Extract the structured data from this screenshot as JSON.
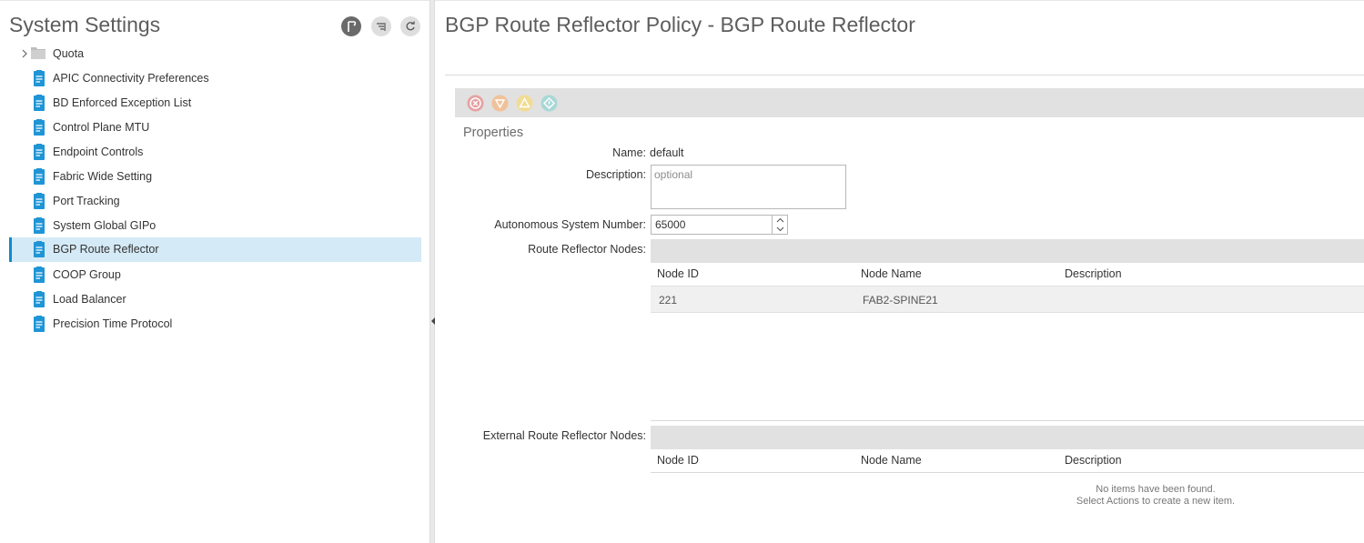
{
  "left_panel": {
    "title": "System Settings",
    "header_buttons": [
      "pin-icon",
      "filter-list-icon",
      "refresh-icon"
    ],
    "tree": [
      {
        "label": "Quota",
        "icon": "folder-icon",
        "expandable": true
      },
      {
        "label": "APIC Connectivity Preferences",
        "icon": "policy-doc-icon"
      },
      {
        "label": "BD Enforced Exception List",
        "icon": "policy-doc-icon"
      },
      {
        "label": "Control Plane MTU",
        "icon": "policy-doc-icon"
      },
      {
        "label": "Endpoint Controls",
        "icon": "policy-doc-icon"
      },
      {
        "label": "Fabric Wide Setting",
        "icon": "policy-doc-icon"
      },
      {
        "label": "Port Tracking",
        "icon": "policy-doc-icon"
      },
      {
        "label": "System Global GIPo",
        "icon": "policy-doc-icon"
      },
      {
        "label": "BGP Route Reflector",
        "icon": "policy-doc-icon",
        "selected": true
      },
      {
        "label": "COOP Group",
        "icon": "policy-doc-icon"
      },
      {
        "label": "Load Balancer",
        "icon": "policy-doc-icon"
      },
      {
        "label": "Precision Time Protocol",
        "icon": "policy-doc-icon"
      }
    ]
  },
  "main": {
    "title": "BGP Route Reflector Policy - BGP Route Reflector",
    "fault_icons": [
      "critical-fault-icon",
      "major-fault-icon",
      "minor-fault-icon",
      "warning-fault-icon"
    ],
    "properties_label": "Properties",
    "form": {
      "name_label": "Name:",
      "name_value": "default",
      "description_label": "Description:",
      "description_placeholder": "optional",
      "asn_label": "Autonomous System Number:",
      "asn_value": "65000",
      "rr_nodes_label": "Route Reflector Nodes:",
      "ext_rr_nodes_label": "External Route Reflector Nodes:"
    },
    "route_reflector_nodes": {
      "columns": [
        "Node ID",
        "Node Name",
        "Description"
      ],
      "rows": [
        {
          "node_id": "221",
          "node_name": "FAB2-SPINE21",
          "description": ""
        }
      ]
    },
    "external_route_reflector_nodes": {
      "columns": [
        "Node ID",
        "Node Name",
        "Description"
      ],
      "rows": [],
      "empty_line_1": "No items have been found.",
      "empty_line_2": "Select Actions to create a new item."
    }
  },
  "colors": {
    "accent": "#0d8bd1",
    "selected_bg": "#d4eaf6",
    "fault_critical": "#e5a3a3",
    "fault_major": "#f0c29a",
    "fault_minor": "#f2dc95",
    "fault_warning": "#a8d8d6"
  }
}
